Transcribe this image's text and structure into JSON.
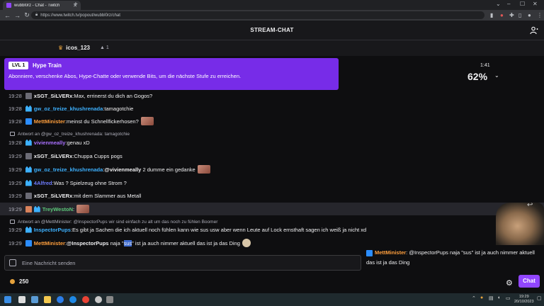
{
  "browser": {
    "tab_title": "wubbl0rz - Chat - Twitch",
    "url": "https://www.twitch.tv/popout/wubbl0rz/chat"
  },
  "header": {
    "title": "STREAM-CHAT"
  },
  "pinned": {
    "user": "icos_123",
    "count": "1"
  },
  "hype_train": {
    "level": "LVL 1",
    "title": "Hype Train",
    "description": "Abonniere, verschenke Abos, Hype-Chatte oder verwende Bits, um die nächste Stufe zu erreichen.",
    "time": "1:41",
    "percent": "62%"
  },
  "messages": [
    {
      "time": "19:28",
      "user": "xSGT_SiLVERx",
      "color": "#efeff1",
      "text": "Max, errinerst du dich an Gogos?"
    },
    {
      "time": "19:28",
      "user": "gw_oz_treize_khushrenada",
      "color": "#3db1ff",
      "text": "tamagotchie"
    },
    {
      "time": "19:28",
      "user": "MettMinister",
      "color": "#ff9f3d",
      "text": "meinst du Schnellfickerhosen?"
    },
    {
      "reply": "Antwort an @gw_oz_treize_khushrenada: tamagotchie"
    },
    {
      "time": "19:28",
      "user": "vivienmeally",
      "color": "#a970ff",
      "text": "genau xD"
    },
    {
      "time": "19:29",
      "user": "xSGT_SiLVERx",
      "color": "#efeff1",
      "text": "Chuppa Cupps pogs"
    },
    {
      "time": "19:29",
      "user": "gw_oz_treize_khushrenada",
      "color": "#3db1ff",
      "mention": "@vivienmeally",
      "text": "2 dumme ein gedanke"
    },
    {
      "time": "19:29",
      "user": "4Alfred",
      "color": "#6e7cff",
      "text": "Was ? Spielzeug ohne Strom ?"
    },
    {
      "time": "19:29",
      "user": "xSGT_SiLVERx",
      "color": "#efeff1",
      "text": "mit dem Slammer aus Metall"
    },
    {
      "time": "19:29",
      "user": "TreyWestoN",
      "color": "#5cc97a",
      "text": ""
    },
    {
      "reply": "Antwort an @MettMinister: @InspectorPups wir sind einfach zu alt um das noch zu fühlen Boomer"
    },
    {
      "time": "19:29",
      "user": "InspectorPups",
      "color": "#3db1ff",
      "text": "Es gibt ja Sachen die ich aktuell noch fühlen kann wie sus usw aber wenn Leute auf Lock ernsthaft sagen ich weiß ja nicht xd"
    },
    {
      "time": "19:29",
      "user": "MettMinister",
      "color": "#ff9f3d",
      "mention": "@InspectorPups",
      "pre": "naja \"",
      "selected": "sus",
      "text": "\" ist ja auch nimmer aktuell das ist ja das Ding"
    }
  ],
  "overlay": {
    "user": "MettMinister",
    "text": ": @InspectorPups naja \"sus\" ist ja auch nimmer aktuell das ist ja das Ding"
  },
  "input": {
    "placeholder": "Eine Nachricht senden"
  },
  "footer": {
    "points": "250",
    "chat_button": "Chat"
  },
  "taskbar": {
    "time": "19:29",
    "date": "20/10/2023"
  }
}
